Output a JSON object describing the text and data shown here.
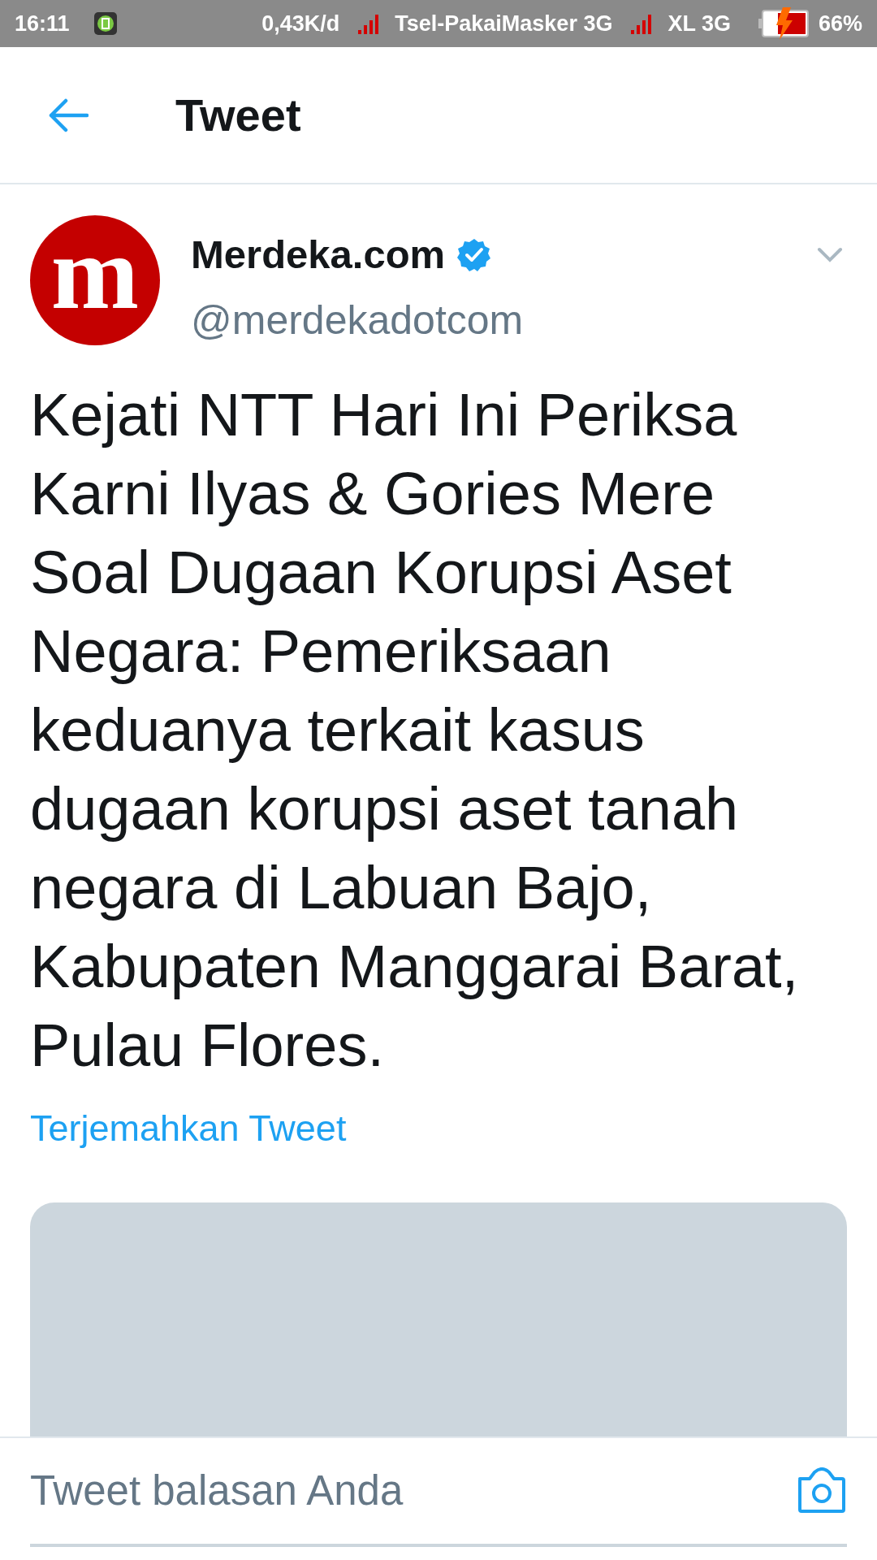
{
  "status_bar": {
    "time": "16:11",
    "speed": "0,43K/d",
    "carriers": [
      {
        "name": "Tsel-PakaiMasker 3G"
      },
      {
        "name": "XL 3G"
      }
    ],
    "battery": "66%",
    "charging": true
  },
  "header": {
    "title": "Tweet"
  },
  "tweet": {
    "name": "Merdeka.com",
    "verified": true,
    "handle": "@merdekadotcom",
    "avatar_letter": "m",
    "text": "Kejati NTT Hari Ini Periksa Karni Ilyas & Gories Mere Soal Dugaan Korupsi Aset Negara: Pemeriksaan keduanya terkait kasus dugaan korupsi aset tanah negara di Labuan Bajo, Kabupaten Manggarai Barat, Pulau Flores.",
    "translate": "Terjemahkan Tweet"
  },
  "reply": {
    "placeholder": "Tweet balasan Anda"
  }
}
